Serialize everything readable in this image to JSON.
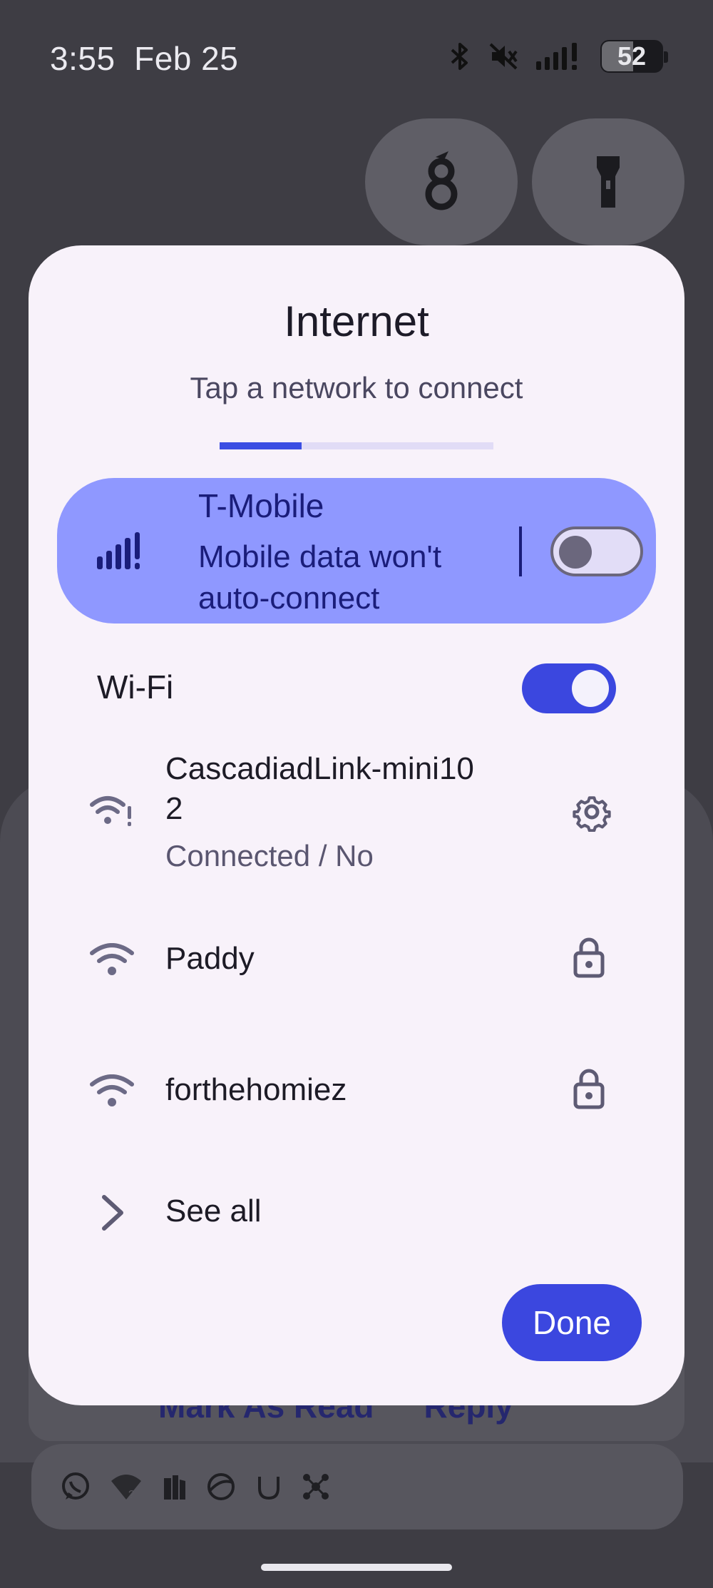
{
  "status_bar": {
    "time": "3:55",
    "date": "Feb 25",
    "battery_level": "52",
    "icons": [
      "bluetooth-icon",
      "mute-icon",
      "cell-signal-icon",
      "battery-icon"
    ]
  },
  "quick_tiles": [
    {
      "name": "wireguard",
      "icon": "wireguard-icon"
    },
    {
      "name": "flashlight",
      "icon": "flashlight-icon"
    }
  ],
  "background": {
    "notification_actions": [
      "Mark As Read",
      "Reply"
    ],
    "app_icons": [
      "whatsapp-icon",
      "wifi-unknown-icon",
      "files-icon",
      "vpn-icon",
      "u-app-icon",
      "nodes-icon"
    ]
  },
  "dialog": {
    "title": "Internet",
    "subtitle": "Tap a network to connect",
    "progress_fraction": 0.3,
    "mobile": {
      "carrier": "T-Mobile",
      "status": "Mobile data won't auto-connect",
      "enabled": false
    },
    "wifi": {
      "label": "Wi-Fi",
      "enabled": true,
      "networks": [
        {
          "name": "CascadiadLink-mini10\n2",
          "status": "Connected / No",
          "icon": "wifi-attention-icon",
          "trailing": "settings-icon"
        },
        {
          "name": "Paddy",
          "icon": "wifi-icon",
          "trailing": "lock-icon"
        },
        {
          "name": "forthehomiez",
          "icon": "wifi-icon",
          "trailing": "lock-icon"
        }
      ],
      "see_all": "See all"
    },
    "done_label": "Done"
  },
  "colors": {
    "accent": "#3b47df",
    "mobile_card": "#8f98ff",
    "dialog_bg": "#f8f2fa",
    "scrim": "#3e3d44"
  }
}
